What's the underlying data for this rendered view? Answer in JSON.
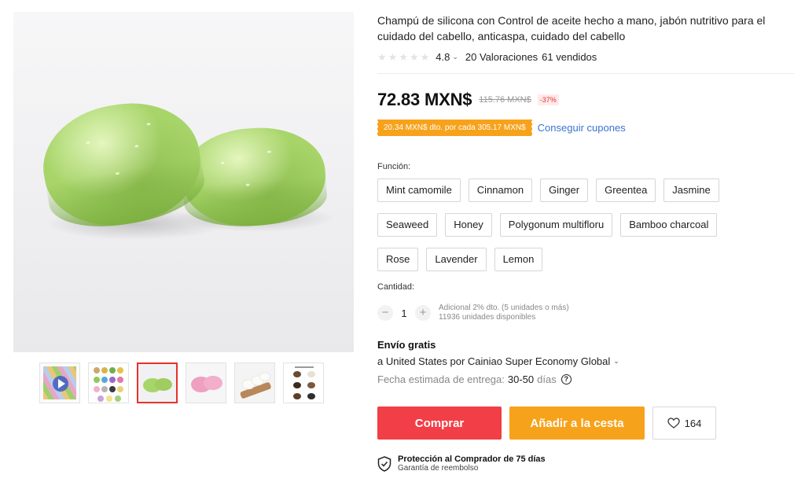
{
  "product": {
    "title": "Champú de silicona con Control de aceite hecho a mano, jabón nutritivo para el cuidado del cabello, anticaspa, cuidado del cabello",
    "rating": "4.8",
    "rating_stars": 0,
    "reviews": "20 Valoraciones",
    "sold": "61 vendidos"
  },
  "price": {
    "current": "72.83 MXN$",
    "original": "115.76 MXN$",
    "discount": "-37%"
  },
  "coupon": {
    "text": "20.34 MXN$ dto. por cada 305.17 MXN$",
    "link": "Conseguir cupones"
  },
  "options": {
    "label": "Función:",
    "rows": [
      [
        "Mint camomile",
        "Cinnamon",
        "Ginger",
        "Greentea",
        "Jasmine"
      ],
      [
        "Seaweed",
        "Honey",
        "Polygonum multifloru",
        "Bamboo charcoal"
      ],
      [
        "Rose",
        "Lavender",
        "Lemon"
      ]
    ]
  },
  "quantity": {
    "label": "Cantidad:",
    "value": "1",
    "minus": "−",
    "plus": "+",
    "info_line1": "Adicional 2% dto. (5 unidades o más)",
    "info_line2": "11936 unidades disponibles"
  },
  "shipping": {
    "title": "Envío gratis",
    "destination": "a United States por Cainiao Super Economy Global",
    "eta_label": "Fecha estimada de entrega:",
    "eta_days": "30-50",
    "eta_unit": "días",
    "help_symbol": "?"
  },
  "actions": {
    "buy": "Comprar",
    "cart": "Añadir a la cesta",
    "wishlist_count": "164"
  },
  "protection": {
    "title": "Protección al Comprador de 75 días",
    "subtitle": "Garantía de reembolso"
  },
  "gallery": {
    "selected_index": 2,
    "thumbnails": [
      "video-thumbnail",
      "variants-grid-thumbnail",
      "green-soap-thumbnail",
      "pink-soap-thumbnail",
      "white-soap-thumbnail",
      "info-sheet-thumbnail"
    ]
  },
  "icons": {
    "chevron": "⌄",
    "heart": "heart-icon",
    "shield": "shield-check-icon",
    "star": "★"
  },
  "colors": {
    "buy": "#f23e46",
    "cart": "#f7a21b",
    "coupon": "#f7a21b",
    "link": "#3a74d0",
    "discount": "#e5322e",
    "soap": "#a8d56a"
  }
}
